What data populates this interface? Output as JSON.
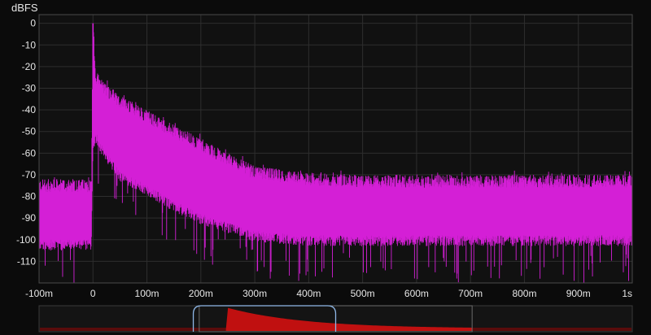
{
  "chart_data": {
    "type": "line",
    "ylabel": "dBFS",
    "xlim": [
      -0.1,
      1.0
    ],
    "ylim": [
      -120,
      4
    ],
    "y_ticks": [
      {
        "v": 0,
        "label": "0"
      },
      {
        "v": -10,
        "label": "-10"
      },
      {
        "v": -20,
        "label": "-20"
      },
      {
        "v": -30,
        "label": "-30"
      },
      {
        "v": -40,
        "label": "-40"
      },
      {
        "v": -50,
        "label": "-50"
      },
      {
        "v": -60,
        "label": "-60"
      },
      {
        "v": -70,
        "label": "-70"
      },
      {
        "v": -80,
        "label": "-80"
      },
      {
        "v": -90,
        "label": "-90"
      },
      {
        "v": -100,
        "label": "-100"
      },
      {
        "v": -110,
        "label": "-110"
      }
    ],
    "x_ticks": [
      {
        "v": -0.1,
        "label": "-100m"
      },
      {
        "v": 0.0,
        "label": "0"
      },
      {
        "v": 0.1,
        "label": "100m"
      },
      {
        "v": 0.2,
        "label": "200m"
      },
      {
        "v": 0.3,
        "label": "300m"
      },
      {
        "v": 0.4,
        "label": "400m"
      },
      {
        "v": 0.5,
        "label": "500m"
      },
      {
        "v": 0.6,
        "label": "600m"
      },
      {
        "v": 0.7,
        "label": "700m"
      },
      {
        "v": 0.8,
        "label": "800m"
      },
      {
        "v": 0.9,
        "label": "900m"
      },
      {
        "v": 1.0,
        "label": "1s"
      }
    ],
    "grid": true,
    "series": [
      {
        "color": "#d41fd6",
        "x": [
          -0.1,
          -0.05,
          -0.003,
          0.0,
          0.005,
          0.02,
          0.05,
          0.1,
          0.15,
          0.2,
          0.25,
          0.3,
          0.4,
          0.5,
          0.6,
          0.7,
          0.8,
          0.9,
          1.0
        ],
        "y_upper": [
          -75,
          -75,
          -75,
          0,
          -25,
          -30,
          -36,
          -43,
          -50,
          -56,
          -63,
          -69,
          -72,
          -73,
          -73,
          -73,
          -73,
          -73,
          -73
        ],
        "y_lower": [
          -100,
          -100,
          -100,
          -55,
          -50,
          -58,
          -68,
          -75,
          -82,
          -88,
          -92,
          -96,
          -98,
          -98,
          -98,
          -98,
          -98,
          -98,
          -98
        ]
      }
    ],
    "overview": {
      "color": "#c01010",
      "selection_start": 0.26,
      "selection_end": 0.5,
      "viewport_end": 0.73
    }
  }
}
